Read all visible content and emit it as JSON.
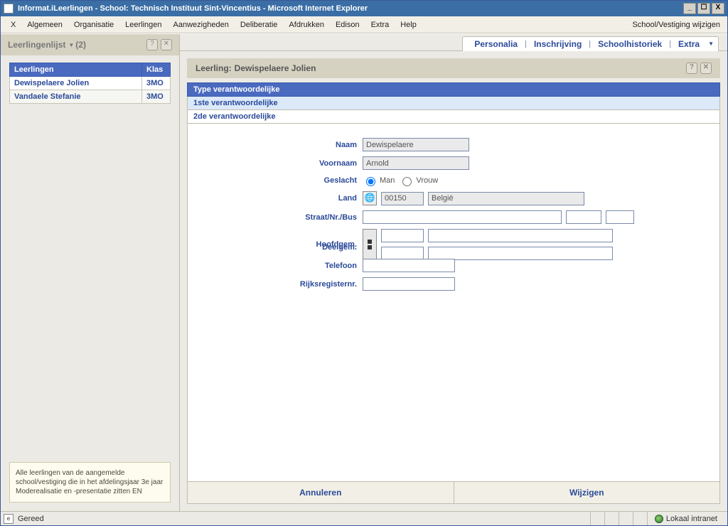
{
  "window": {
    "title": "Informat.iLeerlingen - School: Technisch Instituut Sint-Vincentius - Microsoft Internet Explorer"
  },
  "menu": {
    "items": [
      "X",
      "Algemeen",
      "Organisatie",
      "Leerlingen",
      "Aanwezigheden",
      "Deliberatie",
      "Afdrukken",
      "Edison",
      "Extra",
      "Help"
    ],
    "right": "School/Vestiging wijzigen"
  },
  "sidebar": {
    "title": "Leerlingenlijst",
    "count": "(2)",
    "columns": [
      "Leerlingen",
      "Klas"
    ],
    "rows": [
      {
        "name": "Dewispelaere Jolien",
        "klas": "3MO"
      },
      {
        "name": "Vandaele Stefanie",
        "klas": "3MO"
      }
    ],
    "footer": "Alle leerlingen van de aangemelde school/vestiging die in het afdelingsjaar 3e jaar Moderealisatie en -presentatie zitten EN"
  },
  "tabs": {
    "items": [
      "Personalia",
      "Inschrijving",
      "Schoolhistoriek",
      "Extra"
    ]
  },
  "content": {
    "title_prefix": "Leerling:",
    "title_name": "Dewispelaere Jolien"
  },
  "subtabs": {
    "header": "Type verantwoordelijke",
    "selected": "1ste verantwoordelijke",
    "other": "2de verantwoordelijke"
  },
  "form": {
    "labels": {
      "naam": "Naam",
      "voornaam": "Voornaam",
      "geslacht": "Geslacht",
      "land": "Land",
      "straat": "Straat/Nr./Bus",
      "hoofdgem": "Hoofdgem.",
      "deelgem": "Deelgem.",
      "telefoon": "Telefoon",
      "rr": "Rijksregisternr."
    },
    "values": {
      "naam": "Dewispelaere",
      "voornaam": "Arnold",
      "land_code": "00150",
      "land_name": "België",
      "man": "Man",
      "vrouw": "Vrouw"
    }
  },
  "buttons": {
    "cancel": "Annuleren",
    "save": "Wijzigen"
  },
  "status": {
    "text": "Gereed",
    "zone": "Lokaal intranet"
  }
}
